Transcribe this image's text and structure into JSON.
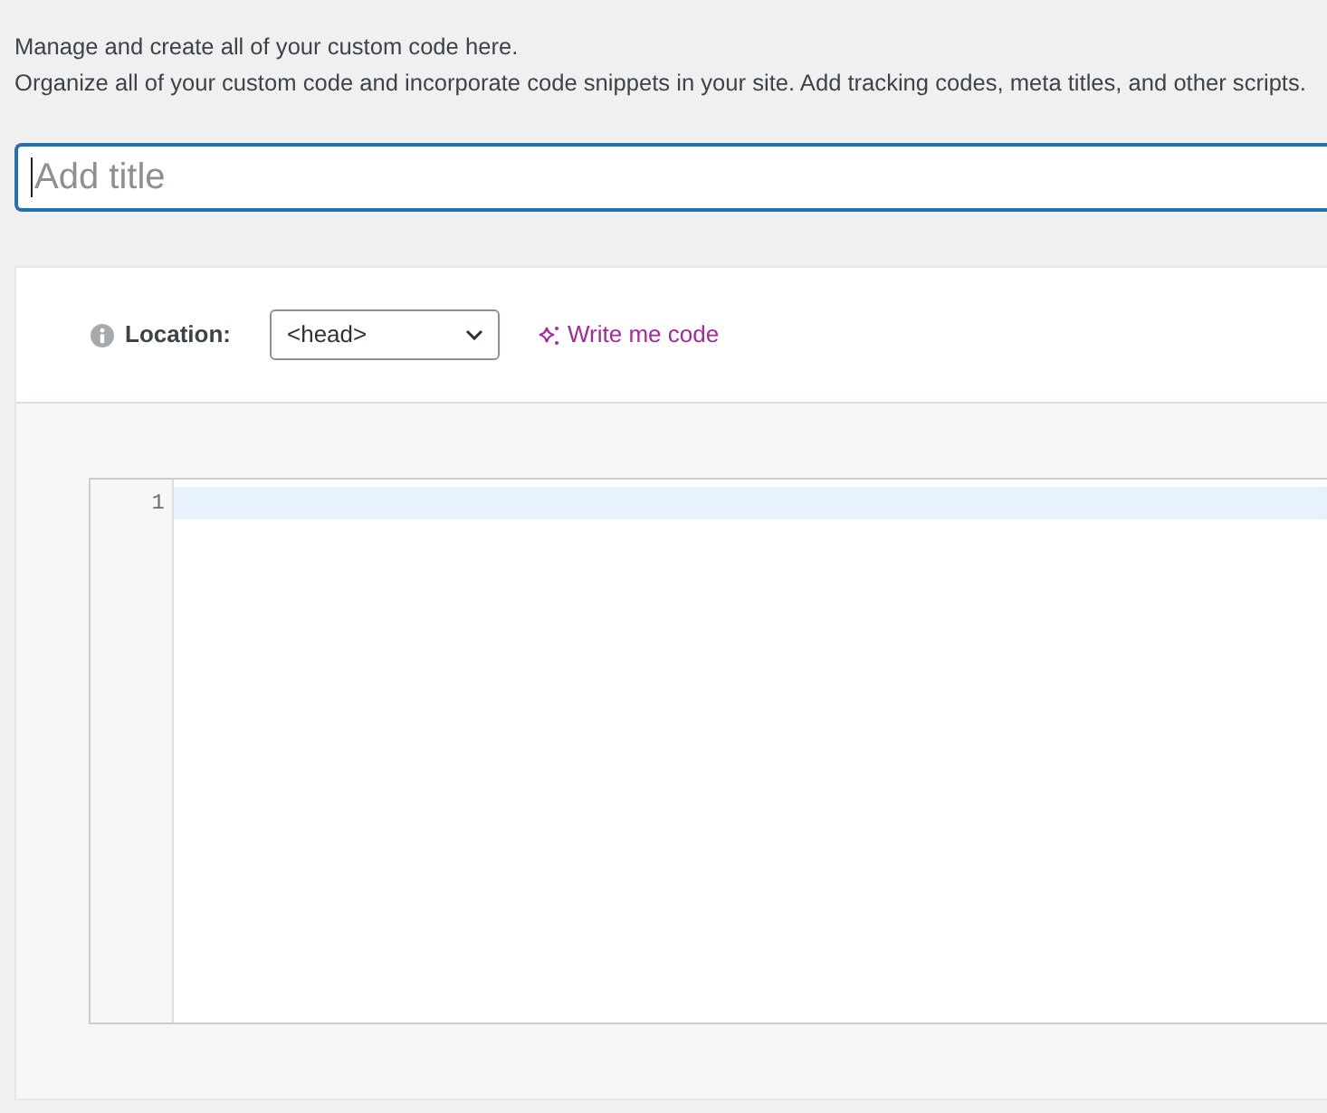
{
  "intro": {
    "lines": [
      "Manage and create all of your custom code here.",
      "Organize all of your custom code and incorporate code snippets in your site. Add tracking codes, meta titles, and other scripts."
    ]
  },
  "title_field": {
    "placeholder": "Add title",
    "focused": true
  },
  "location": {
    "label": "Location:",
    "select_value": "<head>",
    "ai_link": "Write me code"
  },
  "editor": {
    "lines": [
      {
        "number": "1",
        "active": true
      }
    ]
  }
}
